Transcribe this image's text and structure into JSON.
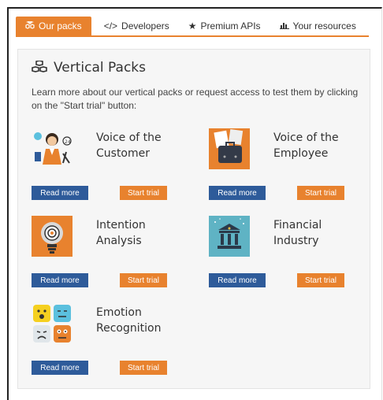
{
  "tabs": [
    {
      "label": "Our packs",
      "icon": "cubes-icon",
      "active": true
    },
    {
      "label": "Developers",
      "icon": "code-icon",
      "active": false
    },
    {
      "label": "Premium APIs",
      "icon": "star-icon",
      "active": false
    },
    {
      "label": "Your resources",
      "icon": "bar-chart-icon",
      "active": false
    }
  ],
  "section": {
    "title": "Vertical Packs",
    "intro": "Learn more about our vertical packs or request access to test them by clicking on the \"Start trial\" button:"
  },
  "packs": [
    {
      "title_line1": "Voice of the",
      "title_line2": "Customer",
      "icon": "customer-agent-icon"
    },
    {
      "title_line1": "Voice of the",
      "title_line2": "Employee",
      "icon": "employee-briefcase-icon"
    },
    {
      "title_line1": "Intention",
      "title_line2": "Analysis",
      "icon": "lightbulb-icon"
    },
    {
      "title_line1": "Financial",
      "title_line2": "Industry",
      "icon": "bank-icon"
    },
    {
      "title_line1": "Emotion",
      "title_line2": "Recognition",
      "icon": "emotion-faces-icon"
    }
  ],
  "buttons": {
    "read_more": "Read more",
    "start_trial": "Start trial"
  },
  "colors": {
    "accent": "#e8822e",
    "button_blue": "#2e5b9a",
    "panel_bg": "#f6f6f6"
  }
}
